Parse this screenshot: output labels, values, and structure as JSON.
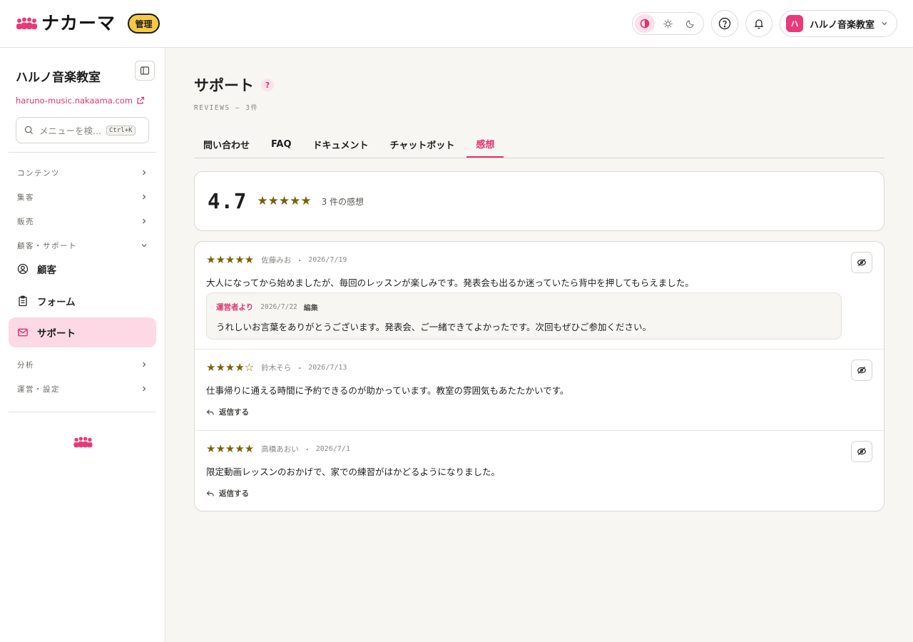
{
  "app": {
    "brand_name": "ナカーマ",
    "admin_badge": "管理",
    "account_initial": "ハ",
    "account_name": "ハルノ音楽教室"
  },
  "theme": {
    "options": [
      "contrast-icon",
      "sun-icon",
      "moon-icon"
    ],
    "active": "contrast-icon"
  },
  "sidebar": {
    "school_name": "ハルノ音楽教室",
    "site_url": "haruno-music.nakaama.com",
    "search_placeholder": "メニューを検索",
    "search_display": "メニューを検...",
    "search_shortcut": "Ctrl+K",
    "sections": [
      {
        "label": "コンテンツ",
        "expanded": false
      },
      {
        "label": "集客",
        "expanded": false
      },
      {
        "label": "販売",
        "expanded": false
      },
      {
        "label": "顧客・サポート",
        "expanded": true
      },
      {
        "label": "分析",
        "expanded": false
      },
      {
        "label": "運営・設定",
        "expanded": false
      }
    ],
    "items": [
      {
        "label": "顧客",
        "icon": "user-circle-icon",
        "active": false
      },
      {
        "label": "フォーム",
        "icon": "clipboard-icon",
        "active": false
      },
      {
        "label": "サポート",
        "icon": "mail-icon",
        "active": true
      }
    ]
  },
  "main": {
    "title": "サポート",
    "help_mark": "?",
    "subtitle": "REVIEWS — 3件",
    "tabs": [
      {
        "label": "問い合わせ",
        "active": false
      },
      {
        "label": "FAQ",
        "active": false
      },
      {
        "label": "ドキュメント",
        "active": false
      },
      {
        "label": "チャットボット",
        "active": false
      },
      {
        "label": "感想",
        "active": true
      }
    ],
    "summary": {
      "score": "4.7",
      "stars": "★★★★★",
      "count": "3 件の感想"
    },
    "reviews": [
      {
        "stars": "★★★★★",
        "rating": 5,
        "name": "佐藤みお",
        "date": "2026/7/19",
        "body": "大人になってから始めましたが、毎回のレッスンが楽しみです。発表会も出るか迷っていたら背中を押してもらえました。",
        "reply": {
          "from": "運営者より",
          "date": "2026/7/22",
          "edit_label": "編集",
          "text": "うれしいお言葉をありがとうございます。発表会、ご一緒できてよかったです。次回もぜひご参加ください。"
        }
      },
      {
        "stars": "★★★★☆",
        "rating": 4,
        "name": "鈴木そら",
        "date": "2026/7/13",
        "body": "仕事帰りに通える時間に予約できるのが助かっています。教室の雰囲気もあたたかいです。",
        "reply_label": "返信する"
      },
      {
        "stars": "★★★★★",
        "rating": 5,
        "name": "高橋あおい",
        "date": "2026/7/1",
        "body": "限定動画レッスンのおかげで、家での練習がはかどるようになりました。",
        "reply_label": "返信する"
      }
    ],
    "separator": "・"
  },
  "colors": {
    "accent": "#e0336f",
    "accent_soft": "#fdd9e6",
    "star": "#7a6108",
    "badge": "#f6c945",
    "background": "#f7f6f3"
  }
}
